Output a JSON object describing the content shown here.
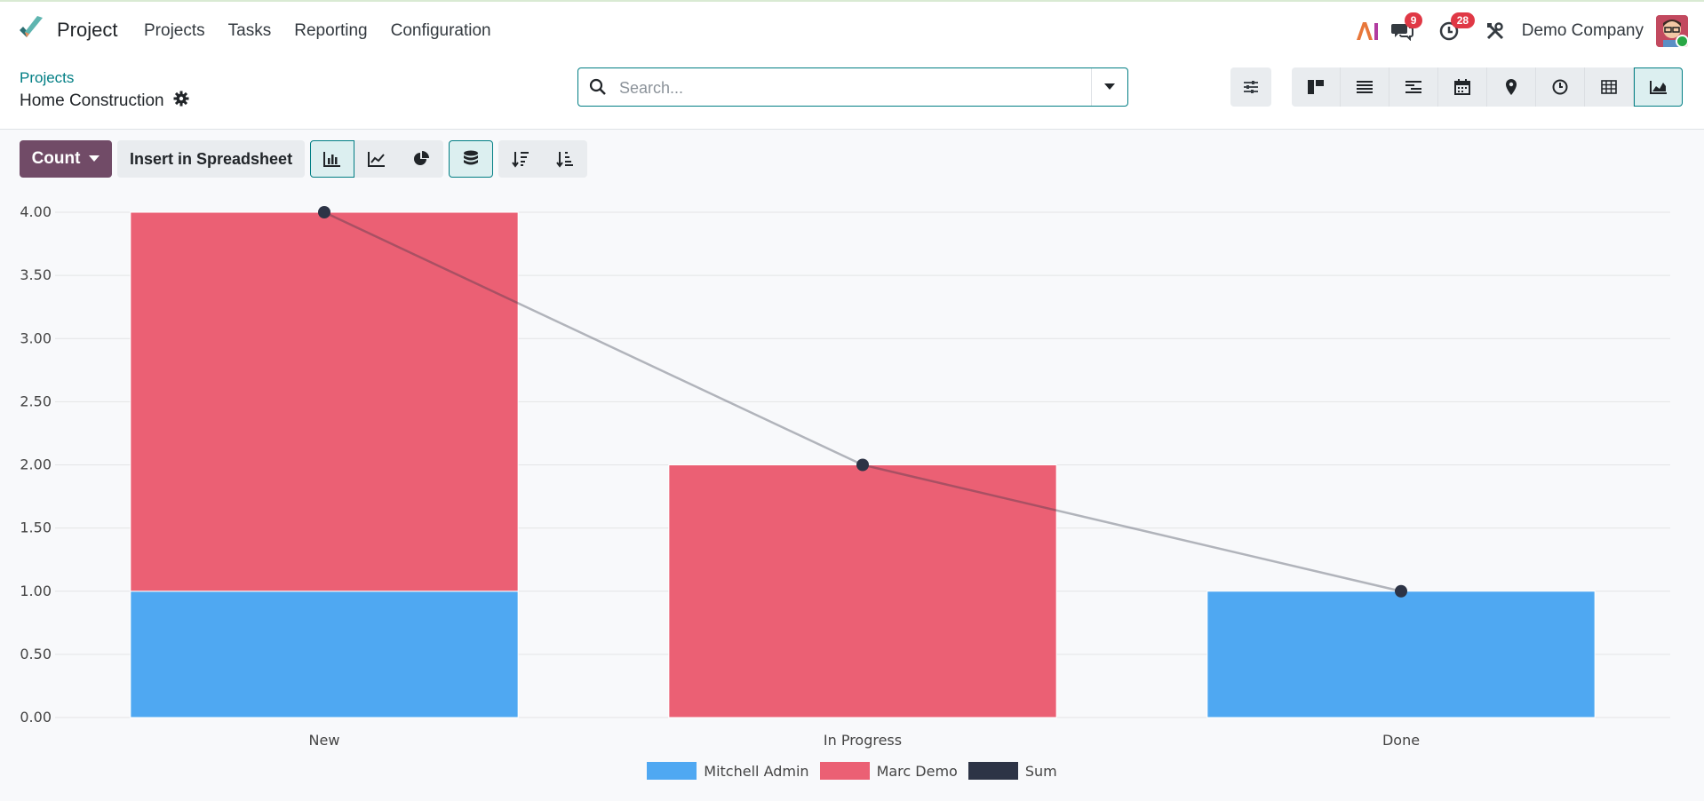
{
  "app": {
    "name": "Project",
    "menu": [
      "Projects",
      "Tasks",
      "Reporting",
      "Configuration"
    ]
  },
  "systray": {
    "messages_count": "9",
    "activities_count": "28",
    "company": "Demo Company"
  },
  "breadcrumb": {
    "parent": "Projects",
    "current": "Home Construction"
  },
  "search": {
    "placeholder": "Search..."
  },
  "toolbar": {
    "measure_label": "Count",
    "spreadsheet_label": "Insert in Spreadsheet"
  },
  "views": [
    "kanban",
    "list",
    "gantt",
    "calendar",
    "map",
    "activity",
    "pivot",
    "graph"
  ],
  "colors": {
    "accent": "#017e84",
    "brand": "#714b67",
    "mitchell": "#4fa8f2",
    "marc": "#eb6074",
    "sum": "#2d3446"
  },
  "chart_data": {
    "type": "bar",
    "stacked": true,
    "categories": [
      "New",
      "In Progress",
      "Done"
    ],
    "series": [
      {
        "name": "Mitchell Admin",
        "values": [
          1,
          0,
          1
        ]
      },
      {
        "name": "Marc Demo",
        "values": [
          3,
          2,
          0
        ]
      }
    ],
    "line_series": {
      "name": "Sum",
      "values": [
        4,
        2,
        1
      ]
    },
    "ylim": [
      0,
      4
    ],
    "yticks": [
      "0.00",
      "0.50",
      "1.00",
      "1.50",
      "2.00",
      "2.50",
      "3.00",
      "3.50",
      "4.00"
    ],
    "grid": true,
    "legend": "bottom-center"
  }
}
